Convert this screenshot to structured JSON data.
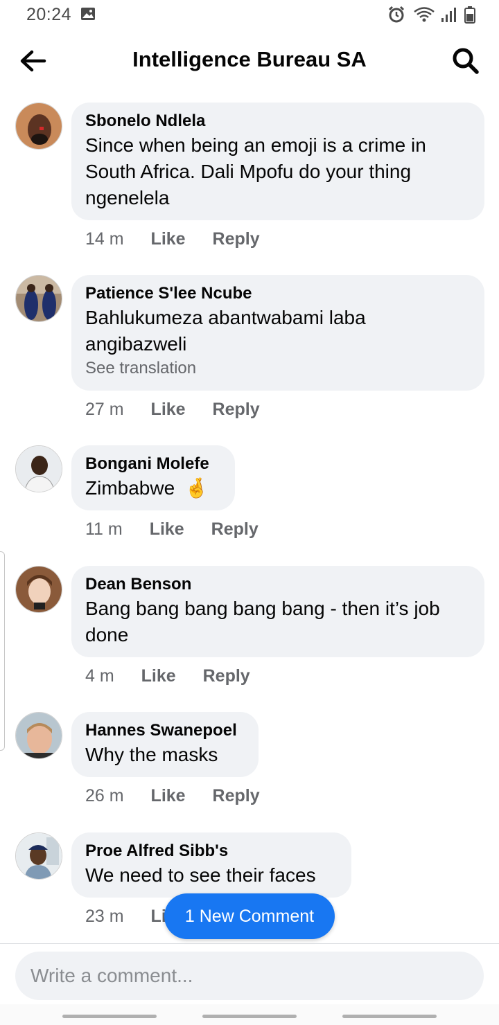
{
  "status": {
    "time": "20:24"
  },
  "header": {
    "title": "Intelligence Bureau SA"
  },
  "comments": [
    {
      "author": "Sbonelo Ndlela",
      "lines": [
        "Since when being an emoji is a crime in",
        "South Africa. Dali Mpofu do your thing",
        "ngenelela"
      ],
      "time": "14 m",
      "like": "Like",
      "reply": "Reply"
    },
    {
      "author": "Patience S'lee Ncube",
      "lines": [
        "Bahlukumeza abantwabami laba",
        "angibazweli"
      ],
      "translation": "See translation",
      "time": "27 m",
      "like": "Like",
      "reply": "Reply"
    },
    {
      "author": "Bongani Molefe",
      "lines": [
        "Zimbabwe"
      ],
      "emoji": "🤞",
      "time": "11 m",
      "like": "Like",
      "reply": "Reply"
    },
    {
      "author": "Dean Benson",
      "lines": [
        "Bang bang bang bang bang - then it’s job",
        "done"
      ],
      "time": "4 m",
      "like": "Like",
      "reply": "Reply"
    },
    {
      "author": "Hannes Swanepoel",
      "lines": [
        "Why the masks"
      ],
      "time": "26 m",
      "like": "Like",
      "reply": "Reply"
    },
    {
      "author": "Proe Alfred Sibb's",
      "lines": [
        "We need to see their faces"
      ],
      "time": "23 m",
      "like": "Li"
    }
  ],
  "new_comment_label": "1 New Comment",
  "composer": {
    "placeholder": "Write a comment..."
  },
  "colors": {
    "accent": "#1877f2",
    "bubble": "#f0f2f5",
    "meta": "#65676b"
  },
  "icons": [
    "back-arrow-icon",
    "search-icon",
    "alarm-icon",
    "wifi-icon",
    "signal-icon",
    "battery-icon",
    "image-icon"
  ]
}
